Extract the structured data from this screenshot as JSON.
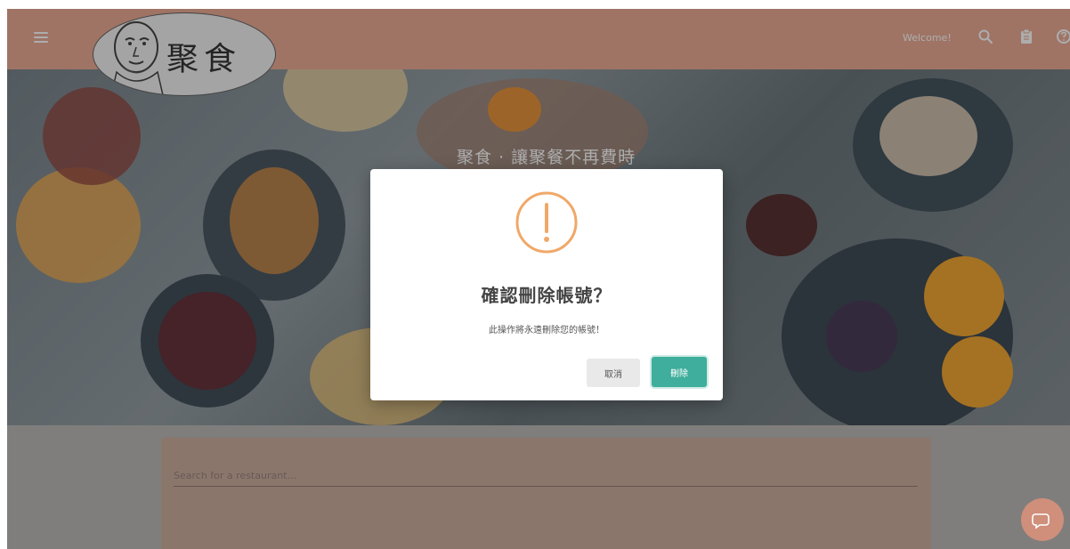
{
  "header": {
    "logo_text": "聚食",
    "welcome": "Welcome!",
    "icons": [
      "menu-icon",
      "search-icon",
      "clipboard-icon",
      "help-icon"
    ]
  },
  "hero": {
    "title": "聚食 · 讓聚餐不再費時"
  },
  "search": {
    "placeholder": "Search for a restaurant..."
  },
  "modal": {
    "icon": "warning-icon",
    "title": "確認刪除帳號？",
    "message": "此操作將永遠刪除您的帳號！",
    "cancel_label": "取消",
    "delete_label": "刪除"
  },
  "fab": {
    "icon": "chat-icon"
  },
  "colors": {
    "header_bg": "#e8a48c",
    "warning": "#f0a868",
    "confirm": "#3fae9c"
  }
}
